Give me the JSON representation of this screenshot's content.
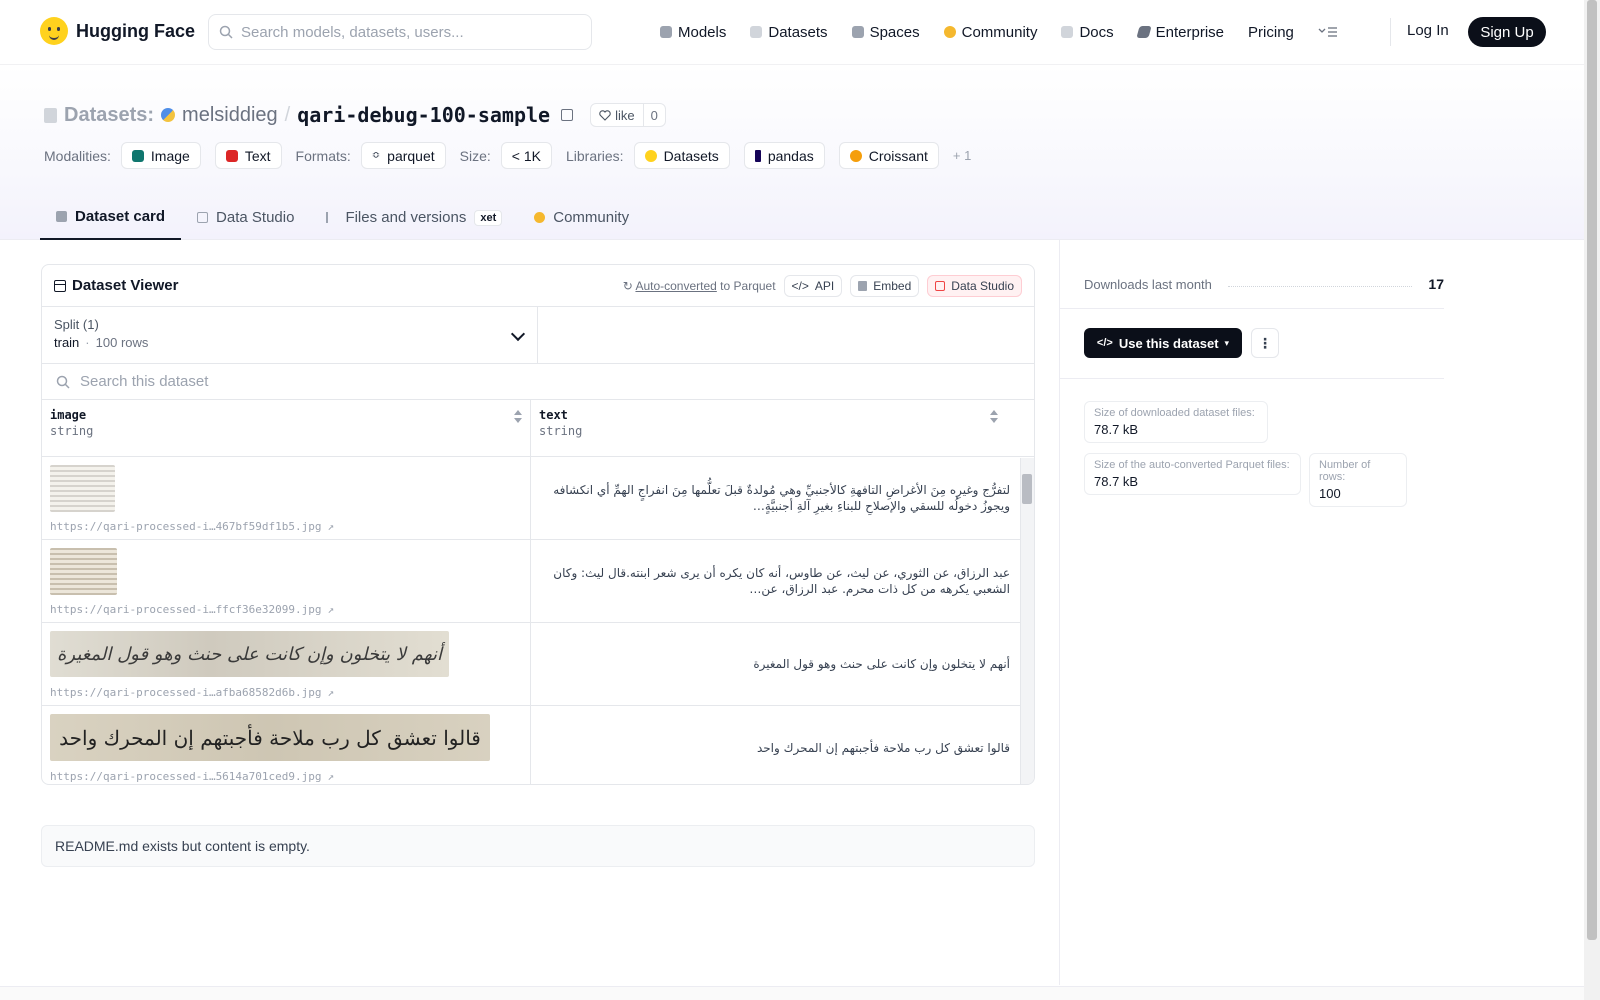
{
  "nav": {
    "brand": "Hugging Face",
    "search_placeholder": "Search models, datasets, users...",
    "links": [
      {
        "label": "Models",
        "icon": "models-icon",
        "color": "#9ca3af"
      },
      {
        "label": "Datasets",
        "icon": "datasets-icon",
        "color": "#d1d5db"
      },
      {
        "label": "Spaces",
        "icon": "spaces-icon",
        "color": "#9ca3af"
      },
      {
        "label": "Community",
        "icon": "community-icon",
        "color": "#f5b82e"
      },
      {
        "label": "Docs",
        "icon": "docs-icon",
        "color": "#d1d5db"
      },
      {
        "label": "Enterprise",
        "icon": "enterprise-icon",
        "color": "#6b7280"
      },
      {
        "label": "Pricing",
        "icon": "",
        "color": ""
      }
    ],
    "login": "Log In",
    "signup": "Sign Up"
  },
  "header": {
    "section_label": "Datasets:",
    "user": "melsiddieg",
    "slash": "/",
    "repo": "qari-debug-100-sample",
    "like_label": "like",
    "like_count": "0",
    "modalities_label": "Modalities:",
    "modalities": [
      {
        "label": "Image",
        "color": "#0f766e"
      },
      {
        "label": "Text",
        "color": "#dc2626"
      }
    ],
    "formats_label": "Formats:",
    "format": "parquet",
    "size_label": "Size:",
    "size": "< 1K",
    "libraries_label": "Libraries:",
    "libraries": [
      {
        "label": "Datasets",
        "color": "#ffd21e"
      },
      {
        "label": "pandas",
        "color": "#150458"
      },
      {
        "label": "Croissant",
        "color": "#f59e0b"
      }
    ],
    "more_libraries": "+ 1",
    "tabs": [
      {
        "label": "Dataset card",
        "active": true
      },
      {
        "label": "Data Studio",
        "active": false
      },
      {
        "label": "Files and versions",
        "active": false,
        "badge": "xet"
      },
      {
        "label": "Community",
        "active": false
      }
    ]
  },
  "viewer": {
    "title": "Dataset Viewer",
    "auto_converted": "Auto-converted",
    "to_parquet": "to Parquet",
    "api": "API",
    "embed": "Embed",
    "data_studio": "Data Studio",
    "split_label": "Split (1)",
    "split_name": "train",
    "split_dot": "·",
    "split_rows": "100 rows",
    "search_placeholder": "Search this dataset",
    "columns": [
      {
        "name": "image",
        "type": "string"
      },
      {
        "name": "text",
        "type": "string"
      }
    ],
    "rows": [
      {
        "url": "https://qari-processed-i…467bf59df1b5.jpg",
        "text": "لتفرُّج وغيرِه مِنَ الأغراضِ التافهةِ كالأجنبيِّ وهي مُولدةٌ قبلَ تعلُّمها مِنَ انفراجٍ الهمِّ أي انكشافه ويجوزُ دخولُه للسقي والإصلاحِ للبناءِ بغيرِ آلةِ أجنبيَّةٍ…"
      },
      {
        "url": "https://qari-processed-i…ffcf36e32099.jpg",
        "text": "عبد الرزاق، عن الثوري، عن ليث، عن طاوس، أنه كان يكره أن يرى شعر ابنته.قال ليث: وكان الشعبي يكرهه من كل ذات محرم. عبد الرزاق، عن…"
      },
      {
        "url": "https://qari-processed-i…afba68582d6b.jpg",
        "text": "أنهم لا يتخلون وإن كانت على حنث وهو قول المغيرة"
      },
      {
        "url": "https://qari-processed-i…5614a701ced9.jpg",
        "text": "قالوا تعشق كل رب ملاحة فأجبتهم إن المحرك واحد"
      }
    ],
    "thumb_texts": [
      "",
      "",
      "أنهم لا يتخلون وإن كانت على حنث وهو قول المغيرة",
      "قالوا تعشق كل رب ملاحة فأجبتهم إن المحرك واحد"
    ]
  },
  "readme": "README.md exists but content is empty.",
  "sidebar": {
    "downloads_label": "Downloads last month",
    "downloads_value": "17",
    "use_button": "Use this dataset",
    "stats": [
      {
        "label": "Size of downloaded dataset files:",
        "value": "78.7 kB"
      },
      {
        "label": "Size of the auto-converted Parquet files:",
        "value": "78.7 kB"
      },
      {
        "label": "Number of rows:",
        "value": "100"
      }
    ]
  }
}
